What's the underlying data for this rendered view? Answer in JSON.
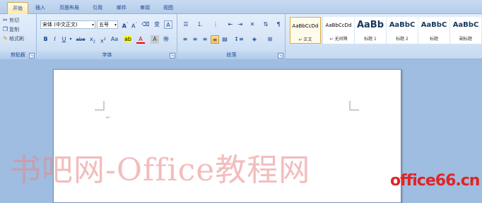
{
  "tabs": [
    {
      "label": "开始",
      "active": true
    },
    {
      "label": "插入",
      "active": false
    },
    {
      "label": "页面布局",
      "active": false
    },
    {
      "label": "引用",
      "active": false
    },
    {
      "label": "邮件",
      "active": false
    },
    {
      "label": "审阅",
      "active": false
    },
    {
      "label": "视图",
      "active": false
    }
  ],
  "clipboard": {
    "cut": "剪切",
    "copy": "复制",
    "format_painter": "格式刷",
    "group_label": "剪贴板"
  },
  "font": {
    "name": "宋体 (中文正文)",
    "size": "五号",
    "group_label": "字体"
  },
  "paragraph": {
    "group_label": "段落"
  },
  "styles": [
    {
      "sample": "AaBbCcDd",
      "name": "↵ 正文",
      "selected": true
    },
    {
      "sample": "AaBbCcDd",
      "name": "↵ 无间隔",
      "selected": false
    },
    {
      "sample": "AaBb",
      "name": "标题 1",
      "selected": false
    },
    {
      "sample": "AaBbC",
      "name": "标题 2",
      "selected": false
    },
    {
      "sample": "AaBbC",
      "name": "标题",
      "selected": false
    },
    {
      "sample": "AaBbC",
      "name": "副标题",
      "selected": false
    }
  ],
  "document": {
    "paragraph_mark": "↵"
  },
  "watermark": {
    "main": "书吧网-Office教程网",
    "site": "office66.cn"
  },
  "colors": {
    "accent_highlight": "#ffc65a",
    "watermark_main": "#e88686",
    "watermark_site": "#e12424"
  }
}
